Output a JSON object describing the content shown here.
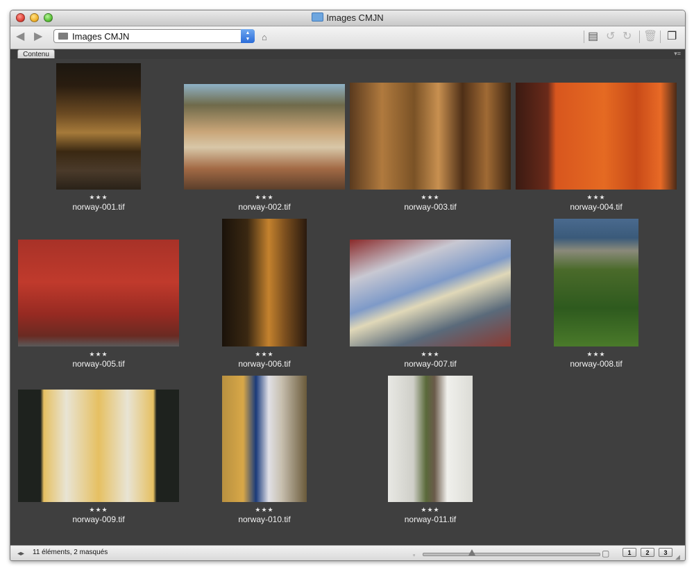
{
  "window": {
    "title": "Images CMJN"
  },
  "toolbar": {
    "path_label": "Images CMJN"
  },
  "tabs": [
    {
      "label": "Contenu"
    }
  ],
  "thumbnails": [
    {
      "filename": "norway-001.tif",
      "rating": "★★★"
    },
    {
      "filename": "norway-002.tif",
      "rating": "★★★"
    },
    {
      "filename": "norway-003.tif",
      "rating": "★★★"
    },
    {
      "filename": "norway-004.tif",
      "rating": "★★★"
    },
    {
      "filename": "norway-005.tif",
      "rating": "★★★"
    },
    {
      "filename": "norway-006.tif",
      "rating": "★★★"
    },
    {
      "filename": "norway-007.tif",
      "rating": "★★★"
    },
    {
      "filename": "norway-008.tif",
      "rating": "★★★"
    },
    {
      "filename": "norway-009.tif",
      "rating": "★★★"
    },
    {
      "filename": "norway-010.tif",
      "rating": "★★★"
    },
    {
      "filename": "norway-011.tif",
      "rating": "★★★"
    }
  ],
  "status": {
    "text": "11 éléments, 2 masqués"
  },
  "view_buttons": [
    {
      "label": "1"
    },
    {
      "label": "2"
    },
    {
      "label": "3"
    }
  ],
  "colors": {
    "content_bg": "#3f3f3f",
    "accent": "#2a6bd8"
  }
}
